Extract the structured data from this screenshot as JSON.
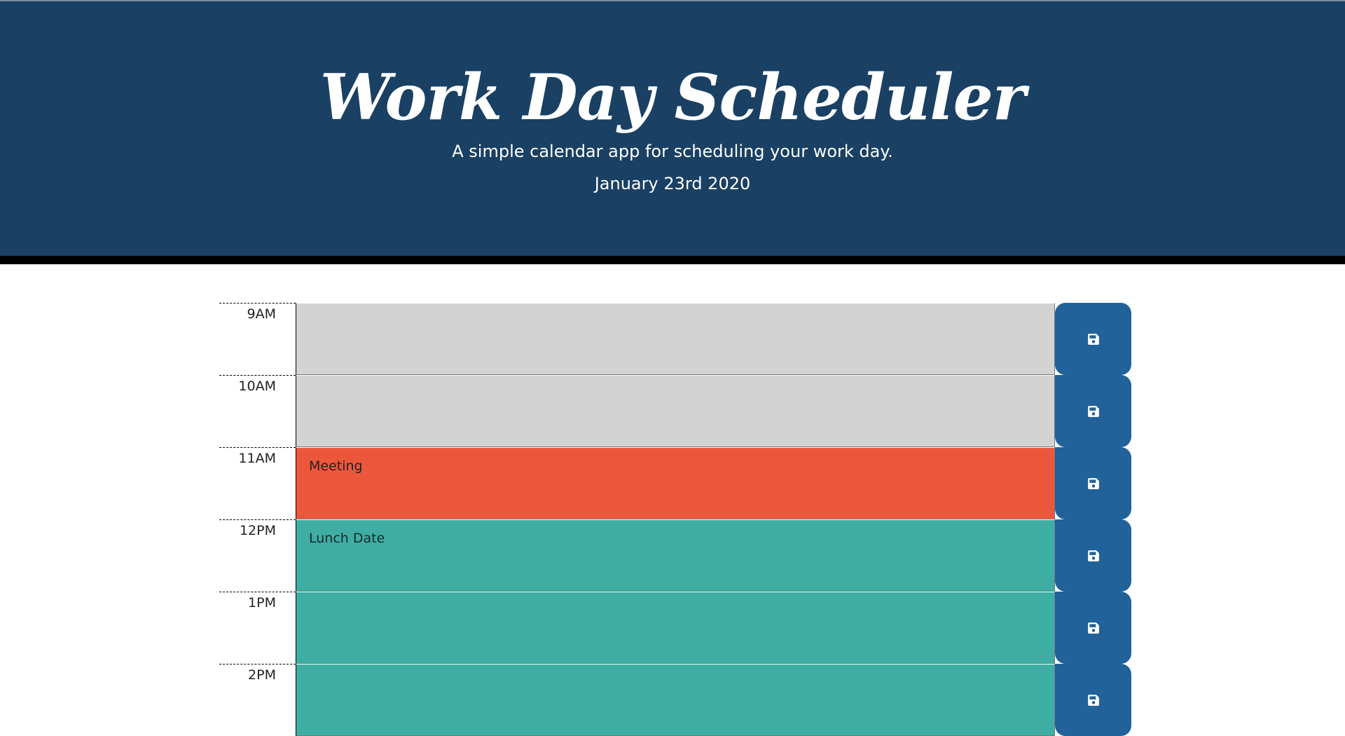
{
  "header": {
    "title": "Work Day Scheduler",
    "subtitle": "A simple calendar app for scheduling your work day.",
    "date": "January 23rd 2020"
  },
  "colors": {
    "header_bg": "#1a4063",
    "past": "#d3d3d3",
    "present": "#ec573c",
    "future": "#3eaea5",
    "save_button": "#21629b"
  },
  "timeblocks": [
    {
      "hour": "9AM",
      "text": "",
      "state": "past"
    },
    {
      "hour": "10AM",
      "text": "",
      "state": "past"
    },
    {
      "hour": "11AM",
      "text": "Meeting",
      "state": "present"
    },
    {
      "hour": "12PM",
      "text": "Lunch Date",
      "state": "future"
    },
    {
      "hour": "1PM",
      "text": "",
      "state": "future"
    },
    {
      "hour": "2PM",
      "text": "",
      "state": "future"
    }
  ],
  "icons": {
    "save": "save-icon"
  }
}
